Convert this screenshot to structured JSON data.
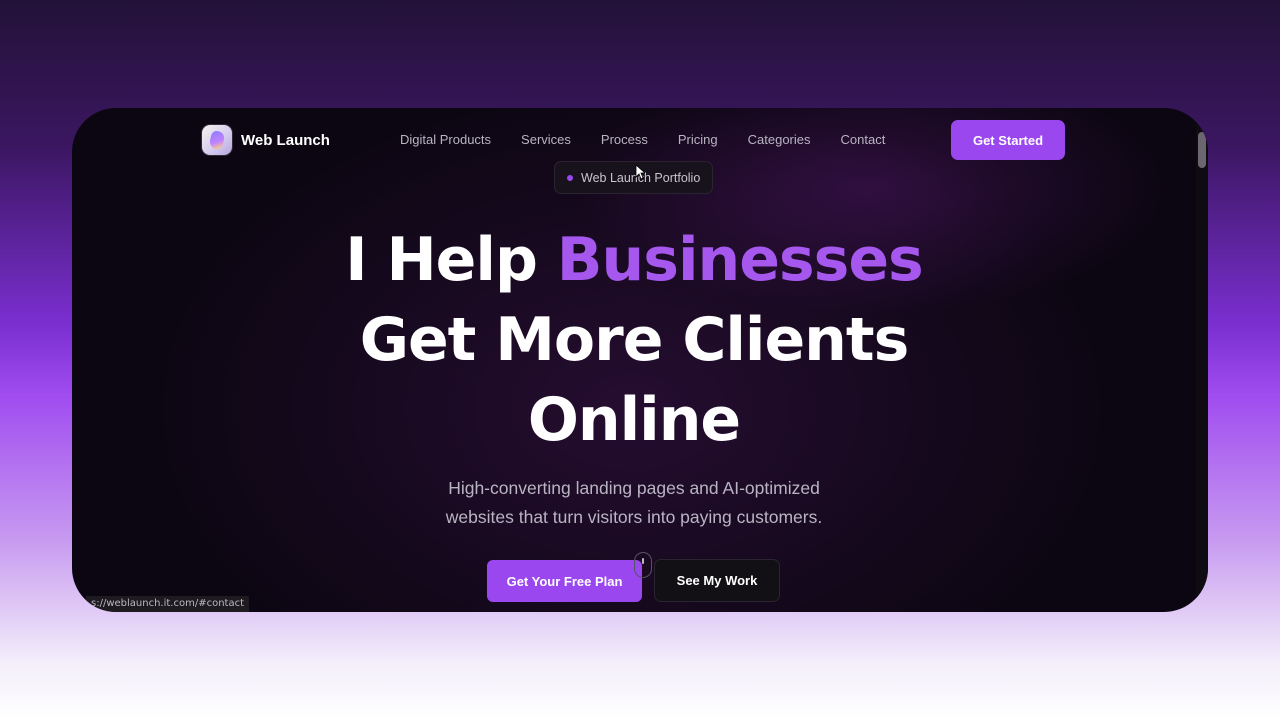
{
  "logo": {
    "text": "Web Launch"
  },
  "nav": {
    "links": [
      "Digital Products",
      "Services",
      "Process",
      "Pricing",
      "Categories",
      "Contact"
    ],
    "cta_label": "Get Started"
  },
  "tooltip": {
    "text": "Web Launch Portfolio"
  },
  "hero": {
    "title_part1": "I Help ",
    "title_accent": "Businesses",
    "title_line2": "Get More Clients",
    "title_line3": "Online",
    "subtitle_line1": "High-converting landing pages and AI-optimized",
    "subtitle_line2": "websites that turn visitors into paying customers.",
    "primary_button": "Get Your Free Plan",
    "secondary_button": "See My Work"
  },
  "status_bar": {
    "url": "s://weblaunch.it.com/#contact"
  },
  "colors": {
    "accent": "#9b47f0",
    "background": "#0d0712",
    "text_muted": "#b9b4c2"
  }
}
